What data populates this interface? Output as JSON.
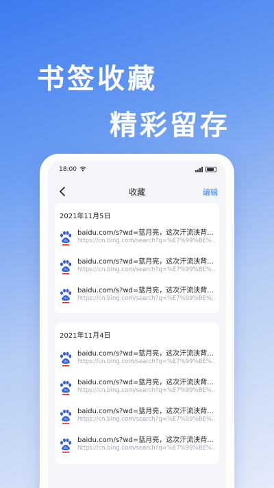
{
  "promo": {
    "line1": "书签收藏",
    "line2": "精彩留存"
  },
  "statusbar": {
    "time": "18:00"
  },
  "nav": {
    "title": "收藏",
    "edit_label": "编辑"
  },
  "groups": [
    {
      "date": "2021年11月5日",
      "items": [
        {
          "title": "baidu.com/s?wd=蓝月亮，这次汗流浃背...",
          "url": "https://cn.bing.com/search?q=%E7%99%BE%...",
          "icon": "baidu-paw-icon"
        },
        {
          "title": "baidu.com/s?wd=蓝月亮，这次汗流浃背...",
          "url": "https://cn.bing.com/search?q=%E7%99%BE%...",
          "icon": "baidu-paw-icon"
        },
        {
          "title": "baidu.com/s?wd=蓝月亮，这次汗流浃背...",
          "url": "https://cn.bing.com/search?q=%E7%99%BE%...",
          "icon": "baidu-paw-icon"
        }
      ]
    },
    {
      "date": "2021年11月4日",
      "items": [
        {
          "title": "baidu.com/s?wd=蓝月亮，这次汗流浃背...",
          "url": "https://cn.bing.com/search?q=%E7%99%BE%...",
          "icon": "baidu-paw-icon"
        },
        {
          "title": "baidu.com/s?wd=蓝月亮，这次汗流浃背...",
          "url": "https://cn.bing.com/search?q=%E7%99%BE%...",
          "icon": "baidu-paw-icon"
        },
        {
          "title": "baidu.com/s?wd=蓝月亮，这次汗流浃背...",
          "url": "https://cn.bing.com/search?q=%E7%99%BE%...",
          "icon": "baidu-paw-icon"
        },
        {
          "title": "baidu.com/s?wd=蓝月亮，这次汗流浃背...",
          "url": "https://cn.bing.com/search?q=%E7%99%BE%...",
          "icon": "baidu-paw-icon"
        }
      ]
    }
  ],
  "colors": {
    "accent": "#3a7cf0",
    "icon_blue": "#2f5fe0",
    "icon_red": "#e0262e"
  }
}
